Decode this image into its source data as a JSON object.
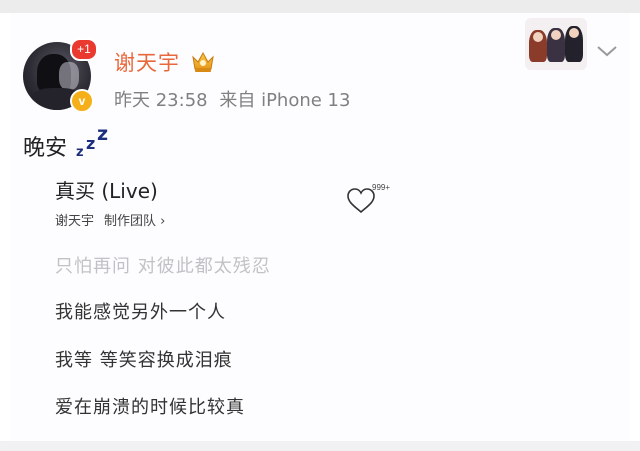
{
  "post": {
    "author": "谢天宇",
    "time": "昨天 23:58",
    "source": "来自 iPhone 13",
    "notification_count": "+1",
    "verified_mark": "v",
    "text": "晚安"
  },
  "music": {
    "title": "真买 (Live)",
    "artist": "谢天宇",
    "credits_link": "制作团队",
    "credits_arrow": "›",
    "like_count": "999+",
    "lyrics": [
      "只怕再问 对彼此都太残忍",
      "我能感觉另外一个人",
      "我等 等笑容换成泪痕",
      "爱在崩溃的时候比较真"
    ]
  },
  "colors": {
    "username": "#e9683b",
    "badge_red": "#ea3a2f",
    "verified_gold": "#f5b019",
    "zzz_blue": "#1d2f7c"
  }
}
